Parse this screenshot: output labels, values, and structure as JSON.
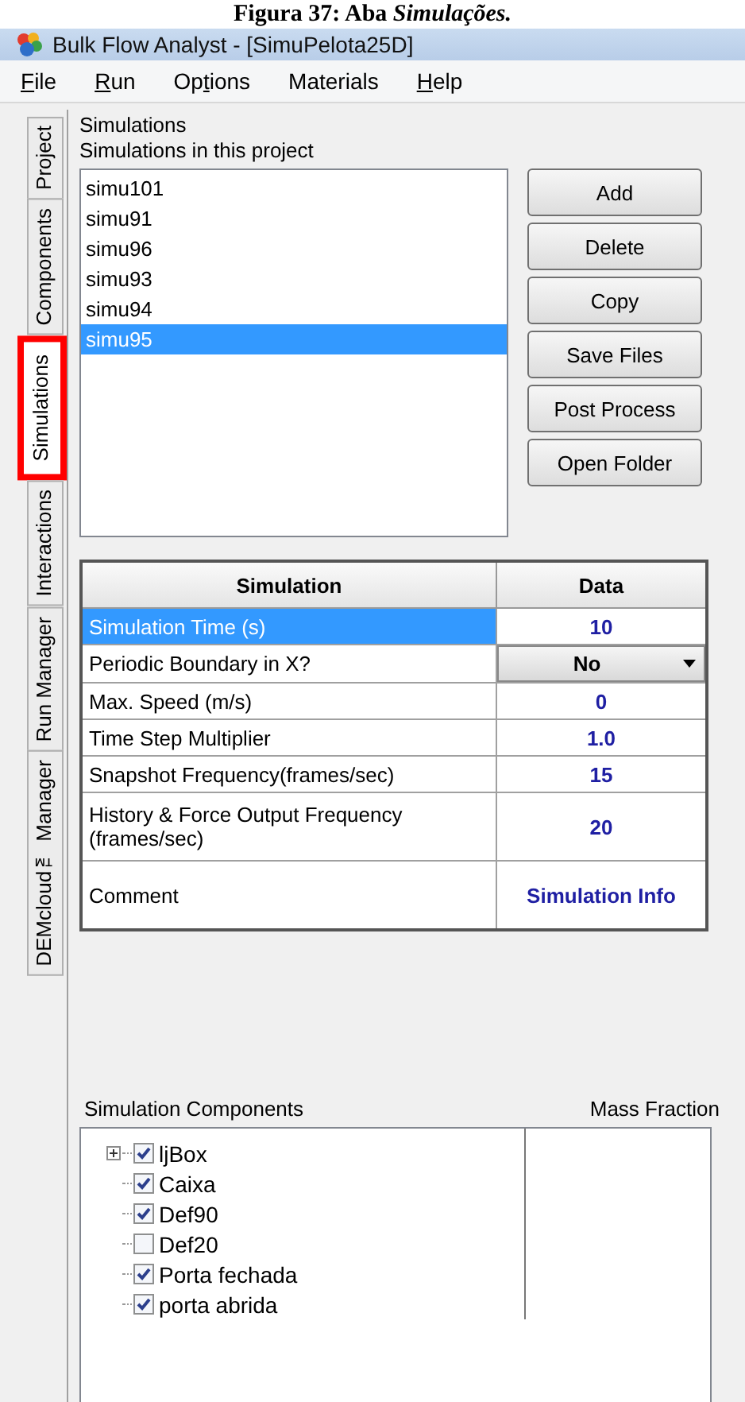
{
  "caption": "Figura 37: Aba *Simulações.*",
  "window": {
    "title": "Bulk Flow Analyst - [SimuPelota25D]"
  },
  "menu": [
    {
      "mnemonic": "F",
      "suffix": "ile"
    },
    {
      "mnemonic": "R",
      "suffix": "un"
    },
    {
      "prefix": "Op",
      "mnemonic": "t",
      "suffix": "ions"
    },
    {
      "prefix": "Materials"
    },
    {
      "mnemonic": "H",
      "suffix": "elp"
    }
  ],
  "side_tabs": [
    {
      "label": "Project",
      "selected": false
    },
    {
      "label": "Components",
      "selected": false
    },
    {
      "label": "Simulations",
      "selected": true
    },
    {
      "label": "Interactions",
      "selected": false
    },
    {
      "label": "Run Manager",
      "selected": false
    },
    {
      "label": "DEMcloud™ Manager",
      "selected": false
    }
  ],
  "group_label": "Simulations",
  "list_label": "Simulations in this project",
  "simulations": [
    {
      "name": "simu101",
      "selected": false
    },
    {
      "name": "simu91",
      "selected": false
    },
    {
      "name": "simu96",
      "selected": false
    },
    {
      "name": "simu93",
      "selected": false
    },
    {
      "name": "simu94",
      "selected": false
    },
    {
      "name": "simu95",
      "selected": true
    }
  ],
  "buttons": [
    "Add",
    "Delete",
    "Copy",
    "Save Files",
    "Post Process",
    "Open Folder"
  ],
  "table": {
    "columns": [
      "Simulation",
      "Data"
    ],
    "rows": [
      {
        "kind": "text",
        "label": "Simulation Time (s)",
        "value": "10",
        "selected": true
      },
      {
        "kind": "dropdown",
        "label": "Periodic Boundary in X?",
        "value": "No",
        "selected": false
      },
      {
        "kind": "text",
        "label": "Max. Speed (m/s)",
        "value": "0",
        "selected": false
      },
      {
        "kind": "text",
        "label": "Time Step Multiplier",
        "value": "1.0",
        "selected": false
      },
      {
        "kind": "text",
        "label": "Snapshot Frequency(frames/sec)",
        "value": "15",
        "selected": false
      },
      {
        "kind": "text",
        "label": "History & Force Output Frequency (frames/sec)",
        "value": "20",
        "selected": false
      },
      {
        "kind": "text",
        "label": "Comment",
        "value": "Simulation Info",
        "selected": false
      }
    ]
  },
  "components": {
    "columns": [
      "Simulation Components",
      "Mass Fraction"
    ],
    "items": [
      {
        "name": "ljBox",
        "checked": true,
        "expanded": false
      },
      {
        "name": "Caixa",
        "checked": true
      },
      {
        "name": "Def90",
        "checked": true
      },
      {
        "name": "Def20",
        "checked": false
      },
      {
        "name": "Porta fechada",
        "checked": true
      },
      {
        "name": "porta abrida",
        "checked": true
      }
    ]
  }
}
